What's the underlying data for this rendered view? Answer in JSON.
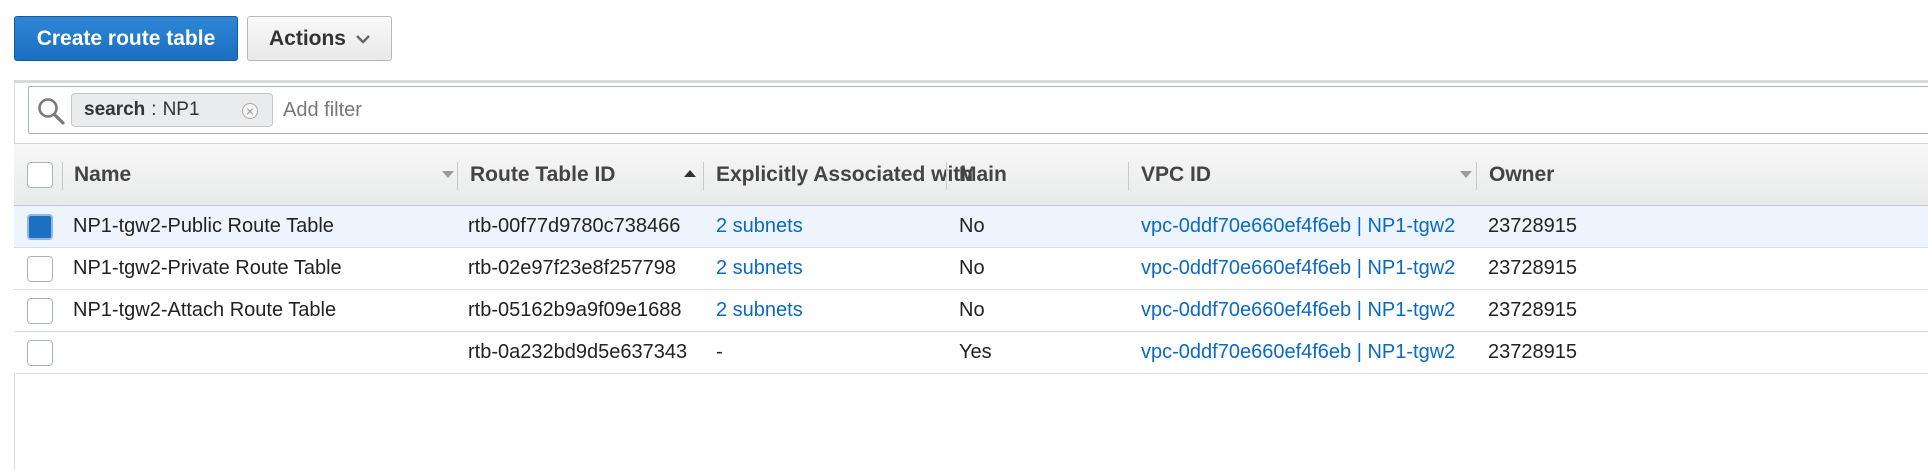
{
  "toolbar": {
    "create_label": "Create route table",
    "actions_label": "Actions"
  },
  "filter": {
    "token_key": "search",
    "token_sep": ":",
    "token_value": "NP1",
    "placeholder": "Add filter"
  },
  "table": {
    "columns": {
      "name": "Name",
      "route_table_id": "Route Table ID",
      "associated": "Explicitly Associated with",
      "main": "Main",
      "vpc_id": "VPC ID",
      "owner": "Owner"
    },
    "rows": [
      {
        "selected": true,
        "name": "NP1-tgw2-Public Route Table",
        "route_table_id": "rtb-00f77d9780c738466",
        "associated": "2 subnets",
        "main": "No",
        "vpc_id": "vpc-0ddf70e660ef4f6eb | NP1-tgw2",
        "owner": "23728915"
      },
      {
        "selected": false,
        "name": "NP1-tgw2-Private Route Table",
        "route_table_id": "rtb-02e97f23e8f257798",
        "associated": "2 subnets",
        "main": "No",
        "vpc_id": "vpc-0ddf70e660ef4f6eb | NP1-tgw2",
        "owner": "23728915"
      },
      {
        "selected": false,
        "name": "NP1-tgw2-Attach Route Table",
        "route_table_id": "rtb-05162b9a9f09e1688",
        "associated": "2 subnets",
        "main": "No",
        "vpc_id": "vpc-0ddf70e660ef4f6eb | NP1-tgw2",
        "owner": "23728915"
      },
      {
        "selected": false,
        "name": "",
        "route_table_id": "rtb-0a232bd9d5e637343",
        "associated": "-",
        "main": "Yes",
        "vpc_id": "vpc-0ddf70e660ef4f6eb | NP1-tgw2",
        "owner": "23728915"
      }
    ]
  },
  "colors": {
    "primary_button": "#1b6fc0",
    "link": "#0a69c2",
    "selected_row": "#edf4fd"
  }
}
